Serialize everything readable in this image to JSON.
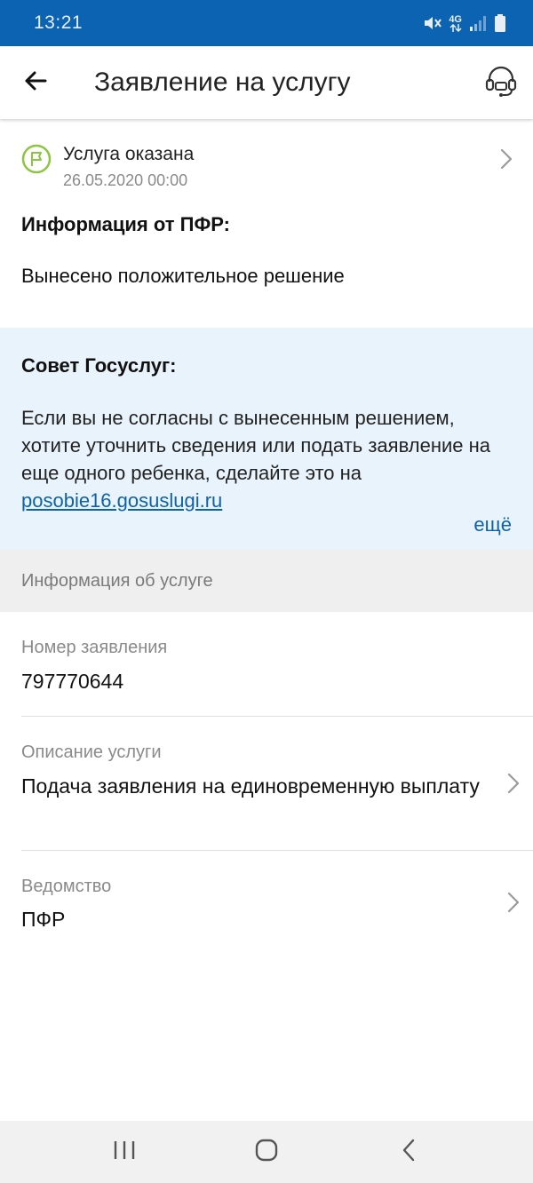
{
  "status_bar": {
    "time": "13:21",
    "network": "4G",
    "icons": [
      "mute-icon",
      "network-4g-icon",
      "signal-icon",
      "battery-icon"
    ]
  },
  "app_bar": {
    "title": "Заявление на услугу",
    "back_icon": "arrow-left-icon",
    "support_icon": "headset-icon"
  },
  "status": {
    "icon": "flag-icon",
    "title": "Услуга оказана",
    "date": "26.05.2020 00:00"
  },
  "pfr_info": {
    "heading": "Информация от ПФР:",
    "text": "Вынесено положительное решение"
  },
  "advice": {
    "heading": "Совет Госуслуг:",
    "text": "Если вы не согласны с вынесенным решением, хотите уточнить сведения или подать заявление на еще одного ребенка, сделайте это на ",
    "link": "posobie16.gosuslugi.ru",
    "more": "ещё"
  },
  "service_info": {
    "section_title": "Информация об услуге",
    "fields": [
      {
        "label": "Номер заявления",
        "value": "797770644"
      },
      {
        "label": "Описание услуги",
        "value": "Подача заявления на единовременную выплату"
      },
      {
        "label": "Ведомство",
        "value": "ПФР"
      }
    ]
  },
  "colors": {
    "status_bar": "#0b63b1",
    "accent": "#0d62a8",
    "advice_bg": "#e9f3fb",
    "flag_green": "#8cc63f"
  },
  "nav_bar": {
    "buttons": [
      "recent-apps-icon",
      "home-icon",
      "back-icon"
    ]
  }
}
